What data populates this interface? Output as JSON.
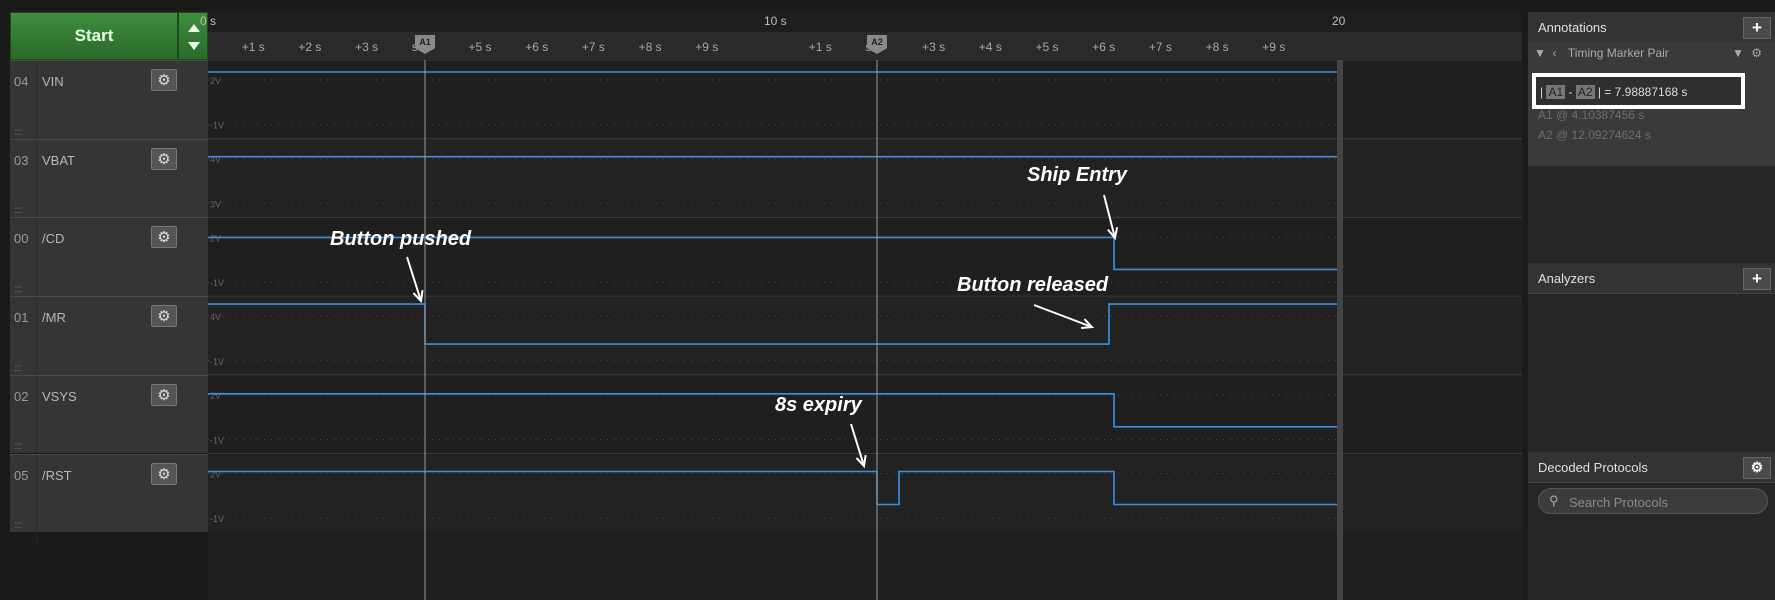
{
  "toolbar": {
    "start_label": "Start"
  },
  "channels": [
    {
      "num": "04",
      "name": "VIN",
      "color": "#d8c419",
      "top_label": "2V",
      "bottom_label": "-1V"
    },
    {
      "num": "03",
      "name": "VBAT",
      "color": "#e08a1a",
      "top_label": "4V",
      "bottom_label": "3V"
    },
    {
      "num": "00",
      "name": "/CD",
      "color": "#333333",
      "top_label": "2V",
      "bottom_label": "-1V"
    },
    {
      "num": "01",
      "name": "/MR",
      "color": "#8a5a2e",
      "top_label": "4V",
      "bottom_label": "-1V"
    },
    {
      "num": "02",
      "name": "VSYS",
      "color": "#d22b2b",
      "top_label": "2V",
      "bottom_label": "-1V"
    },
    {
      "num": "05",
      "name": "/RST",
      "color": "#5aa82e",
      "top_label": "2V",
      "bottom_label": "-1V"
    }
  ],
  "ruler": {
    "major": [
      "0 s",
      "10 s",
      "20"
    ],
    "minor_a": [
      "+1 s",
      "+2 s",
      "+3 s",
      "s",
      "+5 s",
      "+6 s",
      "+7 s",
      "+8 s",
      "+9 s"
    ],
    "minor_b": [
      "+1 s",
      "s",
      "+3 s",
      "+4 s",
      "+5 s",
      "+6 s",
      "+7 s",
      "+8 s",
      "+9 s"
    ],
    "marker_a1": "A1",
    "marker_a2": "A2"
  },
  "annotations_text": {
    "button_pushed": "Button pushed",
    "ship_entry": "Ship Entry",
    "button_released": "Button released",
    "expiry": "8s expiry"
  },
  "right_panel": {
    "annotations_title": "Annotations",
    "marker_pair": "Timing Marker Pair",
    "a1": "A1",
    "a2": "A2",
    "measure_value": "7.98887168 s",
    "a1_time": "A1  @  4.10387456 s",
    "a2_time": "A2  @  12.09274624 s",
    "analyzers_title": "Analyzers",
    "decoded_title": "Decoded Protocols",
    "search_placeholder": "Search Protocols"
  }
}
